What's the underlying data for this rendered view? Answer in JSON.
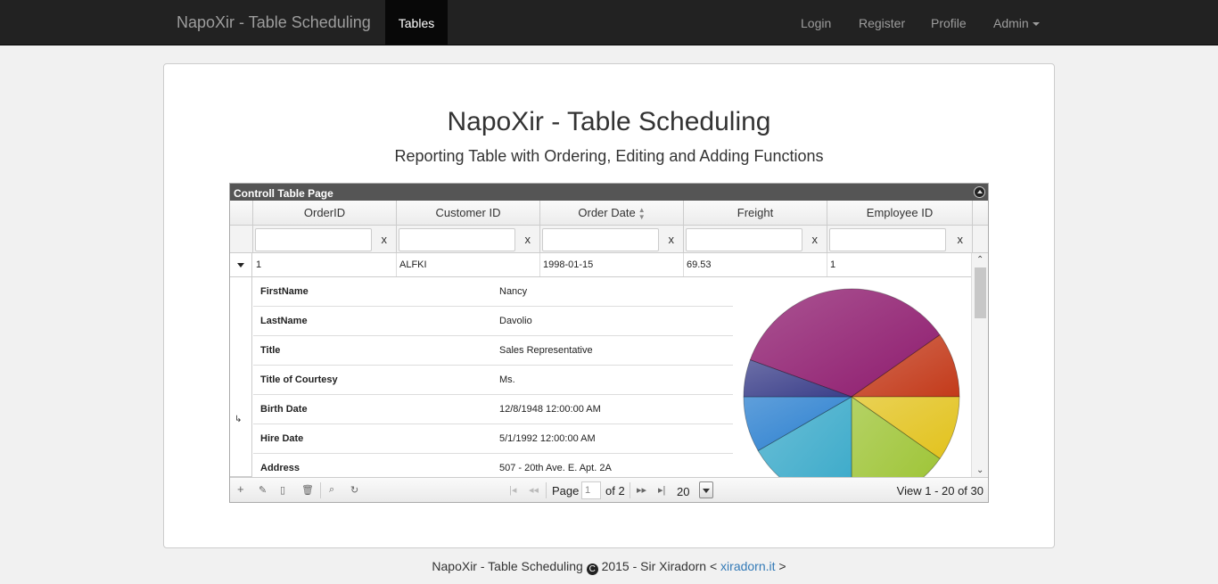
{
  "navbar": {
    "brand": "NapoXir - Table Scheduling",
    "active_tab": "Tables",
    "login": "Login",
    "register": "Register",
    "profile": "Profile",
    "admin": "Admin"
  },
  "page": {
    "title": "NapoXir - Table Scheduling",
    "subtitle": "Reporting Table with Ordering, Editing and Adding Functions"
  },
  "grid": {
    "caption": "Controll Table Page",
    "columns": [
      "OrderID",
      "Customer ID",
      "Order Date",
      "Freight",
      "Employee ID"
    ],
    "sorted_column": "Order Date",
    "filter_clear": "x",
    "row": [
      "1",
      "ALFKI",
      "1998-01-15",
      "69.53",
      "1"
    ],
    "details": [
      {
        "label": "FirstName",
        "value": "Nancy"
      },
      {
        "label": "LastName",
        "value": "Davolio"
      },
      {
        "label": "Title",
        "value": "Sales Representative"
      },
      {
        "label": "Title of Courtesy",
        "value": "Ms."
      },
      {
        "label": "Birth Date",
        "value": "12/8/1948 12:00:00 AM"
      },
      {
        "label": "Hire Date",
        "value": "5/1/1992 12:00:00 AM"
      },
      {
        "label": "Address",
        "value": "507 - 20th Ave. E. Apt. 2A"
      }
    ],
    "pie_colors": [
      "#8e1b6e",
      "#c33a1a",
      "#e2c21c",
      "#9cc332",
      "#39a9c9",
      "#2a7fcf",
      "#3b3f8a"
    ]
  },
  "pager": {
    "page_label": "Page",
    "page_value": "1",
    "of_label": "of 2",
    "page_size": "20",
    "view_text": "View 1 - 20 of 30"
  },
  "footer": {
    "left": "NapoXir - Table Scheduling",
    "copy_symbol": "C",
    "middle": "2015 - Sir Xiradorn <",
    "link": "xiradorn.it",
    "right": ">"
  }
}
